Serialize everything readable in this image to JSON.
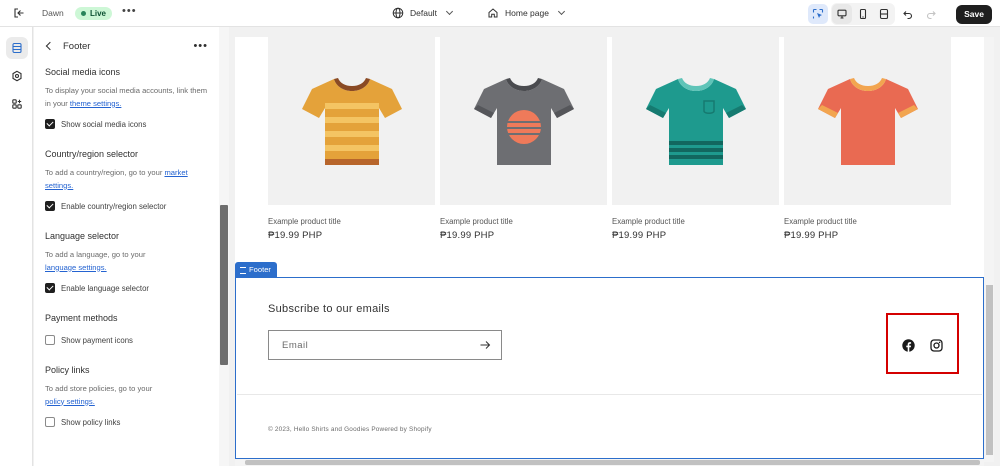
{
  "topbar": {
    "theme_name": "Dawn",
    "status_badge": "Live",
    "theme_selector": "Default",
    "page_selector": "Home page",
    "save_label": "Save"
  },
  "panel": {
    "title": "Footer",
    "sections": [
      {
        "title": "Social media icons",
        "desc": "To display your social media accounts, link them in your ",
        "link": "theme settings.",
        "checkbox": "Show social media icons",
        "checked": true
      },
      {
        "title": "Country/region selector",
        "desc": "To add a country/region, go to your ",
        "link": "market settings.",
        "checkbox": "Enable country/region selector",
        "checked": true
      },
      {
        "title": "Language selector",
        "desc": "To add a language, go to your ",
        "link": "language settings.",
        "checkbox": "Enable language selector",
        "checked": true
      },
      {
        "title": "Payment methods",
        "checkbox": "Show payment icons",
        "checked": false
      },
      {
        "title": "Policy links",
        "desc": "To add store policies, go to your ",
        "link": "policy settings.",
        "checkbox": "Show policy links",
        "checked": false
      }
    ]
  },
  "products": [
    {
      "title": "Example product title",
      "price": "₱19.99 PHP",
      "shirt": "orange-striped"
    },
    {
      "title": "Example product title",
      "price": "₱19.99 PHP",
      "shirt": "gray-sunset"
    },
    {
      "title": "Example product title",
      "price": "₱19.99 PHP",
      "shirt": "teal-stripe"
    },
    {
      "title": "Example product title",
      "price": "₱19.99 PHP",
      "shirt": "coral"
    }
  ],
  "footer": {
    "tag": "Footer",
    "subscribe_heading": "Subscribe to our emails",
    "email_placeholder": "Email",
    "copyright": "© 2023, Hello Shirts and Goodies Powered by Shopify"
  },
  "colors": {
    "accent": "#2c6ecb",
    "highlight_box": "#d40000",
    "live_badge": "#cdf7d6"
  }
}
